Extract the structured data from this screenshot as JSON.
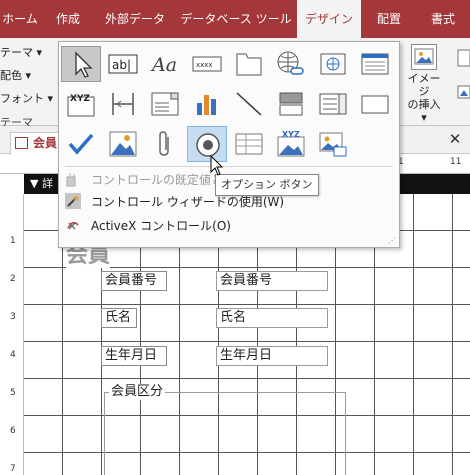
{
  "ribbon_tabs": [
    {
      "label": "ホーム",
      "active": false
    },
    {
      "label": "作成",
      "active": false
    },
    {
      "label": "外部データ",
      "active": false
    },
    {
      "label": "データベース ツール",
      "active": false
    },
    {
      "label": "デザイン",
      "active": true
    },
    {
      "label": "配置",
      "active": false
    },
    {
      "label": "書式",
      "active": false
    }
  ],
  "themes_group": {
    "themes_label": "テーマ",
    "colors_label": "配色",
    "fonts_label": "フォント",
    "group_label": "テーマ"
  },
  "insert_image_button": {
    "line1": "イメージ",
    "line2": "の挿入"
  },
  "document": {
    "tab_label": "会員",
    "section_label": "詳",
    "title_partial": "会員",
    "ruler_top": [
      "1",
      "11"
    ],
    "ruler_left": [
      "1",
      "2",
      "3",
      "4",
      "5",
      "6",
      "7"
    ]
  },
  "form_controls": [
    {
      "label": "会員番号",
      "field": "会員番号"
    },
    {
      "label": "氏名",
      "field": "氏名"
    },
    {
      "label": "生年月日",
      "field": "生年月日"
    }
  ],
  "option_group_title": "会員区分",
  "gallery": {
    "icons": [
      [
        "select-pointer-icon",
        "textbox-icon",
        "label-icon",
        "button-icon",
        "tab-control-icon",
        "hyperlink-icon",
        "web-browser-icon",
        "navigation-control-icon"
      ],
      [
        "option-group-icon",
        "page-break-icon",
        "combo-box-icon",
        "chart-icon",
        "line-icon",
        "toggle-button-icon",
        "list-box-icon",
        "rectangle-icon"
      ],
      [
        "checkbox-icon",
        "unbound-object-frame-icon",
        "attachment-icon",
        "option-button-icon",
        "subform-icon",
        "bound-object-frame-icon",
        "image-icon"
      ]
    ],
    "textbox_text": "ab|",
    "label_text": "Aa",
    "button_text": "xxxx",
    "xyz_text": "XYZ",
    "menu": [
      {
        "label": "コントロールの既定値とし",
        "disabled": true
      },
      {
        "label": "コントロール ウィザードの使用(W)",
        "disabled": false
      },
      {
        "label": "ActiveX コントロール(O)",
        "disabled": false
      }
    ]
  },
  "tooltip": "オプション ボタン",
  "colors": {
    "accent": "#a4373a",
    "hover": "#c5dcf3",
    "check_blue": "#2b6cc4",
    "chart_blue": "#3b6fbf",
    "chart_orange": "#e08a2c"
  }
}
